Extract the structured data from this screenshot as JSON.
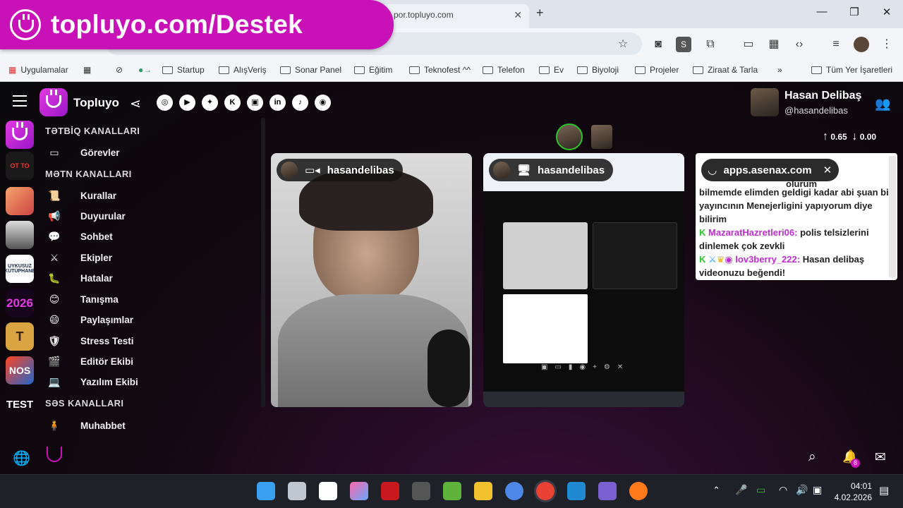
{
  "browser": {
    "tab_title": "por.topluyo.com",
    "bookmarks": [
      "Uygulamalar",
      "Startup",
      "AlışVeriş",
      "Sonar Panel",
      "Eğitim",
      "Teknofest ^^",
      "Telefon",
      "Ev",
      "Biyoloji",
      "Projeler",
      "Ziraat & Tarla",
      "Tüm Yer İşaretleri"
    ]
  },
  "promo": {
    "text": "topluyo.com/Destek"
  },
  "app": {
    "title": "Topluyo",
    "user": {
      "name": "Hasan Delibaş",
      "handle": "@hasandelibas"
    },
    "speed": {
      "up": "0.65",
      "down": "0.00"
    },
    "rail": {
      "badge_2026": "2026",
      "test": "TEST",
      "ot_to": "OT TO",
      "uykusuz": "UYKUSUZ KÜTÜPHANE"
    },
    "notifications_count": "8",
    "categories": {
      "app": "TƏTBİQ KANALLARI",
      "text": "MƏTN KANALLARI",
      "voice": "SƏS KANALLARI"
    },
    "app_channels": [
      "Görevler"
    ],
    "text_channels": [
      "Kurallar",
      "Duyurular",
      "Sohbet",
      "Ekipler",
      "Hatalar",
      "Tanışma",
      "Paylaşımlar",
      "Stress Testi",
      "Editör Ekibi",
      "Yazılım Ekibi"
    ],
    "voice_channels": [
      "Muhabbet"
    ]
  },
  "streams": {
    "cam_label": "hasandelibas",
    "screen_label": "hasandelibas",
    "chat_label": "apps.asenax.com"
  },
  "chat": {
    "lines": [
      {
        "user": "",
        "text": "olurum"
      },
      {
        "user": "",
        "text": "bilmemde elimden geldigi kadar abi şuan bi"
      },
      {
        "user": "",
        "text": "yayıncının Menejerligini yapıyorum diye"
      },
      {
        "user": "",
        "text": "bilirim"
      },
      {
        "user": "MazaratHazretleri06:",
        "text": " polis telsizlerini"
      },
      {
        "user": "",
        "text": "dinlemek çok zevkli"
      },
      {
        "user": "lov3berry_222:",
        "text": " Hasan delibaş"
      },
      {
        "user": "",
        "text": "videonuzu beğendi!"
      }
    ]
  },
  "taskbar": {
    "time": "04:01",
    "date": "4.02.2026"
  },
  "colors": {
    "accent": "#c911b8",
    "mod_green": "#2ac42a",
    "chat_user": "#c02bd6"
  }
}
